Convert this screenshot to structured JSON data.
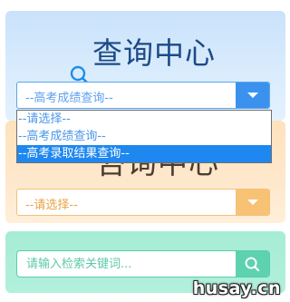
{
  "query_card": {
    "title": "查询中心",
    "select_value": "--高考成绩查询--"
  },
  "dropdown": {
    "options": [
      {
        "label": "--请选择--",
        "selected": false
      },
      {
        "label": "--高考成绩查询--",
        "selected": false
      },
      {
        "label": "--高考录取结果查询--",
        "selected": true
      }
    ]
  },
  "orange_card": {
    "title": "咨询中心",
    "select_value": "--请选择--"
  },
  "search_card": {
    "placeholder": "请输入检索关键词..."
  },
  "watermark": "husay.cn",
  "colors": {
    "blue_accent": "#3b92ee",
    "orange_accent": "#f7c274",
    "green_accent": "#5ed2ae",
    "selected_option": "#1e87f0"
  }
}
